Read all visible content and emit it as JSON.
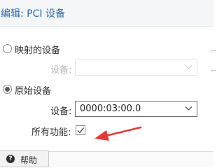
{
  "dialog": {
    "title": "编辑: PCI 设备"
  },
  "mapped_device": {
    "radio_label": "映射的设备",
    "selected": false,
    "device_label": "设备:",
    "device_value": ""
  },
  "raw_device": {
    "radio_label": "原始设备",
    "selected": true,
    "device_label": "设备:",
    "device_value": "0000:03:00.0",
    "all_functions_label": "所有功能:",
    "all_functions_checked": true
  },
  "footer": {
    "help_label": "帮助",
    "help_icon": "question-icon"
  },
  "annotation": {
    "arrow_color": "#e8392f"
  }
}
